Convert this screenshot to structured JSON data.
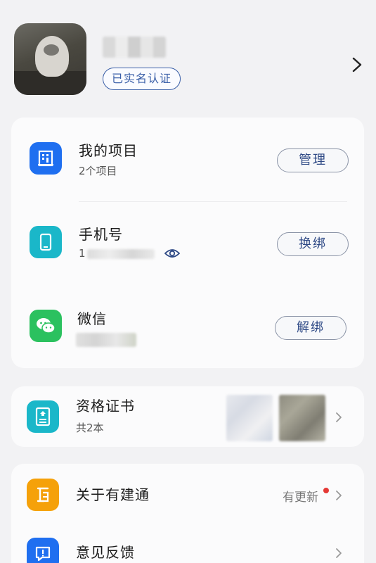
{
  "profile": {
    "verified_label": "已实名认证"
  },
  "account_card": {
    "projects": {
      "title": "我的项目",
      "subtitle": "2个项目",
      "button": "管理"
    },
    "phone": {
      "title": "手机号",
      "value_prefix": "1",
      "button": "换绑"
    },
    "wechat": {
      "title": "微信",
      "button": "解绑"
    }
  },
  "certificates": {
    "title": "资格证书",
    "subtitle": "共2本"
  },
  "settings": {
    "about": {
      "title": "关于有建通",
      "status": "有更新"
    },
    "feedback": {
      "title": "意见反馈"
    }
  },
  "colors": {
    "blue_icon": "#1f6ff0",
    "teal_icon": "#1ab7c9",
    "green_icon": "#2bc15f",
    "orange_icon": "#f5a10a",
    "accent_text": "#2f4a86",
    "badge_dot": "#e53935"
  },
  "icons": [
    "building-icon",
    "phone-icon",
    "wechat-icon",
    "certificate-icon",
    "about-icon",
    "feedback-icon",
    "eye-icon",
    "chevron-right-icon"
  ]
}
